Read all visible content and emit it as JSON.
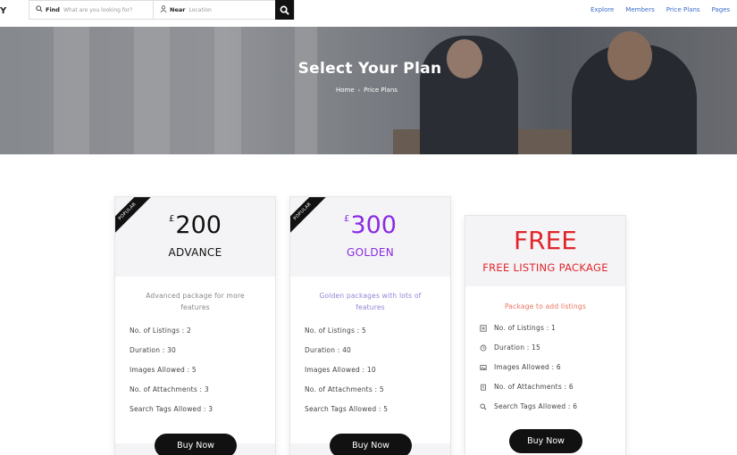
{
  "header": {
    "logo_text": "Y",
    "search": {
      "find_label": "Find",
      "find_placeholder": "What are you looking for?",
      "near_label": "Near",
      "near_placeholder": "Location"
    },
    "nav": [
      "Explore",
      "Members",
      "Price Plans",
      "Pages"
    ]
  },
  "hero": {
    "title": "Select Your Plan",
    "breadcrumb": {
      "home": "Home",
      "separator": "›",
      "current": "Price Plans"
    }
  },
  "plans": [
    {
      "ribbon": "POPULAR",
      "currency": "£",
      "amount": "200",
      "name": "ADVANCE",
      "accent": "#111111",
      "description": "Advanced package for more features",
      "features": [
        "No. of Listings : 2",
        "Duration : 30",
        "Images Allowed : 5",
        "No. of Attachments : 3",
        "Search Tags Allowed : 3"
      ],
      "button": "Buy Now"
    },
    {
      "ribbon": "POPULAR",
      "currency": "£",
      "amount": "300",
      "name": "GOLDEN",
      "accent": "#8a2be2",
      "description": "Golden packages with lots of features",
      "features": [
        "No. of Listings : 5",
        "Duration : 40",
        "Images Allowed : 10",
        "No. of Attachments : 5",
        "Search Tags Allowed : 5"
      ],
      "button": "Buy Now"
    },
    {
      "amount": "FREE",
      "name": "FREE LISTING PACKAGE",
      "accent": "#e0262b",
      "description": "Package to add listings",
      "description_color": "#e8735f",
      "features": [
        "No. of Listings : 1",
        "Duration : 15",
        "Images Allowed : 6",
        "No. of Attachments : 6",
        "Search Tags Allowed : 6"
      ],
      "feature_icons": [
        "listing-icon",
        "clock-icon",
        "image-icon",
        "attachment-icon",
        "tag-search-icon"
      ],
      "button": "Buy Now"
    }
  ]
}
